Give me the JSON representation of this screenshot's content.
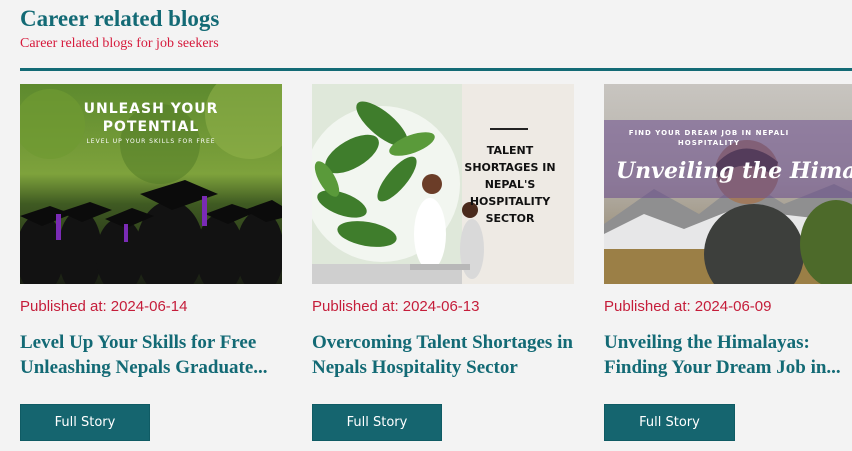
{
  "section": {
    "title": "Career related blogs",
    "subtitle": "Career related blogs for job seekers"
  },
  "colors": {
    "accent": "#136a75",
    "date": "#c51d3a",
    "button_bg": "#15656f",
    "background": "#f3f3f3"
  },
  "cards": [
    {
      "published_label": "Published at:",
      "published_date": "2024-06-14",
      "title_line1": "Level Up Your Skills for Free",
      "title_line2": "Unleashing Nepals Graduate...",
      "button_label": "Full Story",
      "image": {
        "line1": "UNLEASH YOUR",
        "line2": "POTENTIAL",
        "line3": "LEVEL UP YOUR SKILLS FOR FREE"
      }
    },
    {
      "published_label": "Published at:",
      "published_date": "2024-06-13",
      "title_line1": "Overcoming Talent Shortages in",
      "title_line2": "Nepals Hospitality Sector",
      "button_label": "Full Story",
      "image": {
        "line1": "TALENT",
        "line2": "SHORTAGES IN",
        "line3": "NEPAL'S",
        "line4": "HOSPITALITY",
        "line5": "SECTOR"
      }
    },
    {
      "published_label": "Published at:",
      "published_date": "2024-06-09",
      "title_line1": "Unveiling the Himalayas:",
      "title_line2": "Finding Your Dream Job in...",
      "button_label": "Full Story",
      "image": {
        "line1": "FIND YOUR DREAM JOB IN NEPALI",
        "line2": "HOSPITALITY",
        "line3": "Unveiling the Himalayas"
      }
    }
  ]
}
